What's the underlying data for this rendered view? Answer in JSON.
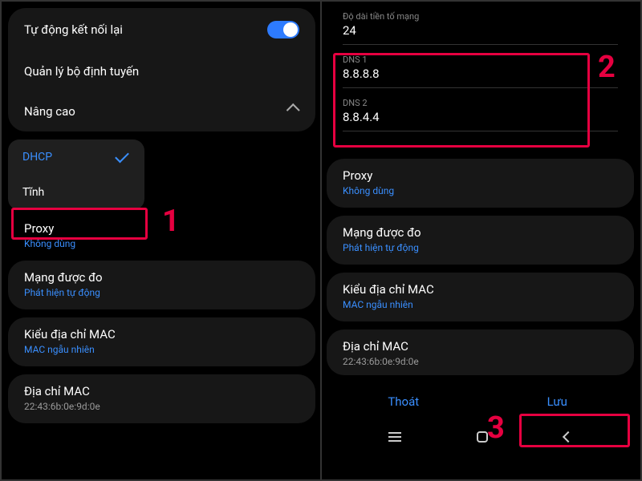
{
  "left": {
    "autoReconnect": "Tự động kết nối lại",
    "routerMgmt": "Quản lý bộ định tuyến",
    "advanced": "Nâng cao",
    "dropdown": {
      "dhcp": "DHCP",
      "tinh": "Tĩnh"
    },
    "proxy": {
      "label": "Proxy",
      "value": "Không dùng"
    },
    "metered": {
      "label": "Mạng được đo",
      "value": "Phát hiện tự động"
    },
    "macType": {
      "label": "Kiểu địa chỉ MAC",
      "value": "MAC ngẫu nhiên"
    },
    "macAddr": {
      "label": "Địa chỉ MAC",
      "value": "22:43:6b:0e:9d:0e"
    }
  },
  "right": {
    "prefix": {
      "label": "Độ dài tiền tố mạng",
      "value": "24"
    },
    "dns1": {
      "label": "DNS 1",
      "value": "8.8.8.8"
    },
    "dns2": {
      "label": "DNS 2",
      "value": "8.8.4.4"
    },
    "proxy": {
      "label": "Proxy",
      "value": "Không dùng"
    },
    "metered": {
      "label": "Mạng được đo",
      "value": "Phát hiện tự động"
    },
    "macType": {
      "label": "Kiểu địa chỉ MAC",
      "value": "MAC ngẫu nhiên"
    },
    "macAddr": {
      "label": "Địa chỉ MAC",
      "value": "22:43:6b:0e:9d:0e"
    },
    "cancel": "Thoát",
    "save": "Lưu"
  },
  "callouts": {
    "one": "1",
    "two": "2",
    "three": "3"
  }
}
